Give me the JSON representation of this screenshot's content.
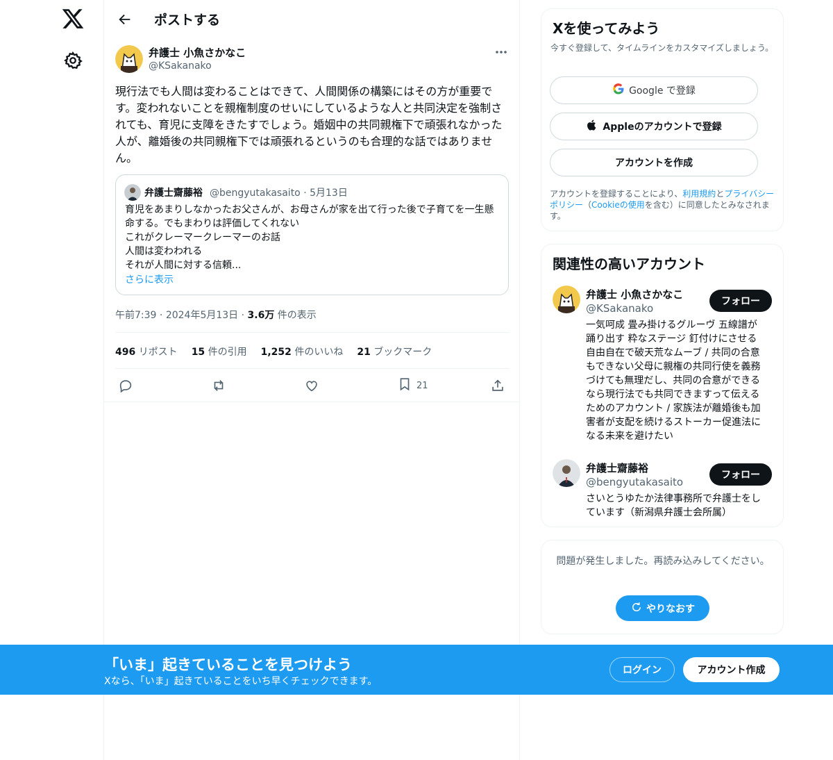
{
  "header": {
    "title": "ポストする"
  },
  "post": {
    "author_name": "弁護士 小魚さかなこ",
    "author_handle": "@KSakanako",
    "text": "現行法でも人間は変わることはできて、人間関係の構築にはその方が重要です。変われないことを親権制度のせいにしているような人と共同決定を強制されても、育児に支障をきたすでしょう。婚姻中の共同親権下で頑張れなかった人が、離婚後の共同親権下では頑張れるというのも合理的な話ではありません。",
    "time": "午前7:39",
    "date": "2024年5月13日",
    "views_value": "3.6万",
    "views_label": "件の表示",
    "sep": "·"
  },
  "quote": {
    "name": "弁護士齋藤裕",
    "handle": "@bengyutakasaito · 5月13日",
    "text": "育児をあまりしなかったお父さんが、お母さんが家を出て行った後で子育てを一生懸命する。でもまわりは評価してくれない\nこれがクレーマークレーマーのお話\n人間は変わわれる\nそれが人間に対する信頼...",
    "show_more": "さらに表示"
  },
  "stats": {
    "reposts_value": "496",
    "reposts_label": "リポスト",
    "quotes_value": "15",
    "quotes_label": "件の引用",
    "likes_value": "1,252",
    "likes_label": "件のいいね",
    "bookmarks_value": "21",
    "bookmarks_label": "ブックマーク"
  },
  "actions": {
    "bookmark_count": "21"
  },
  "signup": {
    "title": "Xを使ってみよう",
    "subtitle": "今すぐ登録して、タイムラインをカスタマイズしましょう。",
    "google": "Google で登録",
    "apple": "Appleのアカウントで登録",
    "create": "アカウントを作成",
    "terms_1": "アカウントを登録することにより、",
    "terms_link1": "利用規約",
    "terms_2": "と",
    "terms_link2": "プライバシーポリシー",
    "terms_3": "（",
    "terms_link3": "Cookieの使用",
    "terms_4": "を含む）に同意したとみなされます。"
  },
  "related": {
    "title": "関連性の高いアカウント",
    "accounts": [
      {
        "name": "弁護士 小魚さかなこ",
        "handle": "@KSakanako",
        "bio": "一気呵成 畳み掛けるグルーヴ 五線譜が踊り出す 粋なステージ 釘付けにさせる 自由自在で破天荒なムーブ / 共同の合意もできない父母に親権の共同行使を義務づけても無理だし、共同の合意ができるなら現行法でも共同できますって伝えるためのアカウント / 家族法が離婚後も加害者が支配を続けるストーカー促進法になる未来を避けたい",
        "follow": "フォロー"
      },
      {
        "name": "弁護士齋藤裕",
        "handle": "@bengyutakasaito",
        "bio": "さいとうゆたか法律事務所で弁護士をしています（新潟県弁護士会所属）",
        "follow": "フォロー"
      }
    ]
  },
  "error": {
    "text": "問題が発生しました。再読み込みしてください。",
    "retry": "やりなおす"
  },
  "banner": {
    "title": "「いま」起きていることを見つけよう",
    "subtitle": "Xなら、「いま」起きていることをいち早くチェックできます。",
    "login": "ログイン",
    "signup": "アカウント作成"
  },
  "colors": {
    "accent": "#1d9bf0",
    "text": "#0f1419",
    "muted": "#536471",
    "border": "#eff3f4"
  },
  "icons": [
    "x-logo-icon",
    "gear-icon",
    "back-arrow-icon",
    "more-icon",
    "reply-icon",
    "repost-icon",
    "like-icon",
    "bookmark-icon",
    "share-icon",
    "google-icon",
    "apple-icon",
    "refresh-icon"
  ]
}
